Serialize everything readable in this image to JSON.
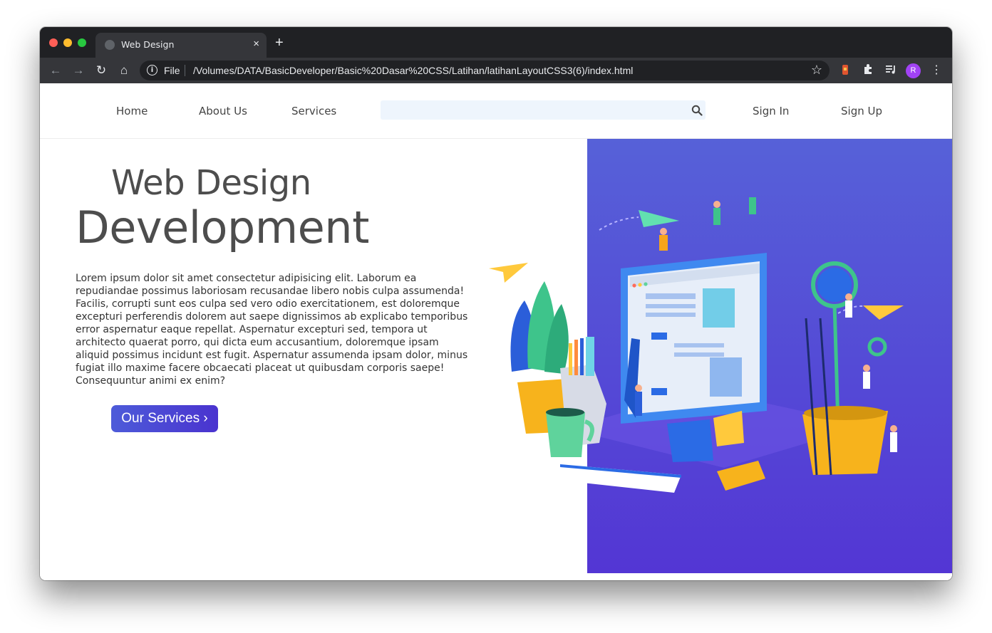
{
  "browser": {
    "tab_title": "Web Design",
    "tab_close": "×",
    "new_tab": "+",
    "url_scheme": "File",
    "url": "/Volumes/DATA/BasicDeveloper/Basic%20Dasar%20CSS/Latihan/latihanLayoutCSS3(6)/index.html",
    "profile_initial": "R"
  },
  "nav": {
    "links": [
      "Home",
      "About Us",
      "Services"
    ],
    "search_value": "",
    "sign_in": "Sign In",
    "sign_up": "Sign Up"
  },
  "hero": {
    "subtitle": "Web Design",
    "title": "Development",
    "paragraph": "Lorem ipsum dolor sit amet consectetur adipisicing elit. Laborum ea repudiandae possimus laboriosam recusandae libero nobis culpa assumenda! Facilis, corrupti sunt eos culpa sed vero odio exercitationem, est doloremque excepturi perferendis dolorem aut saepe dignissimos ab explicabo temporibus error aspernatur eaque repellat. Aspernatur excepturi sed, tempora ut architecto quaerat porro, qui dicta eum accusantium, doloremque ipsam aliquid possimus incidunt est fugit. Aspernatur assumenda ipsam dolor, minus fugiat illo maxime facere obcaecati placeat ut quibusdam corporis saepe! Consequuntur animi ex enim?",
    "cta": "Our Services ›"
  },
  "colors": {
    "accent": "#5336d4",
    "accent_light": "#5661d8",
    "text": "#4d4d4d",
    "search_bg": "#eef5fd"
  }
}
